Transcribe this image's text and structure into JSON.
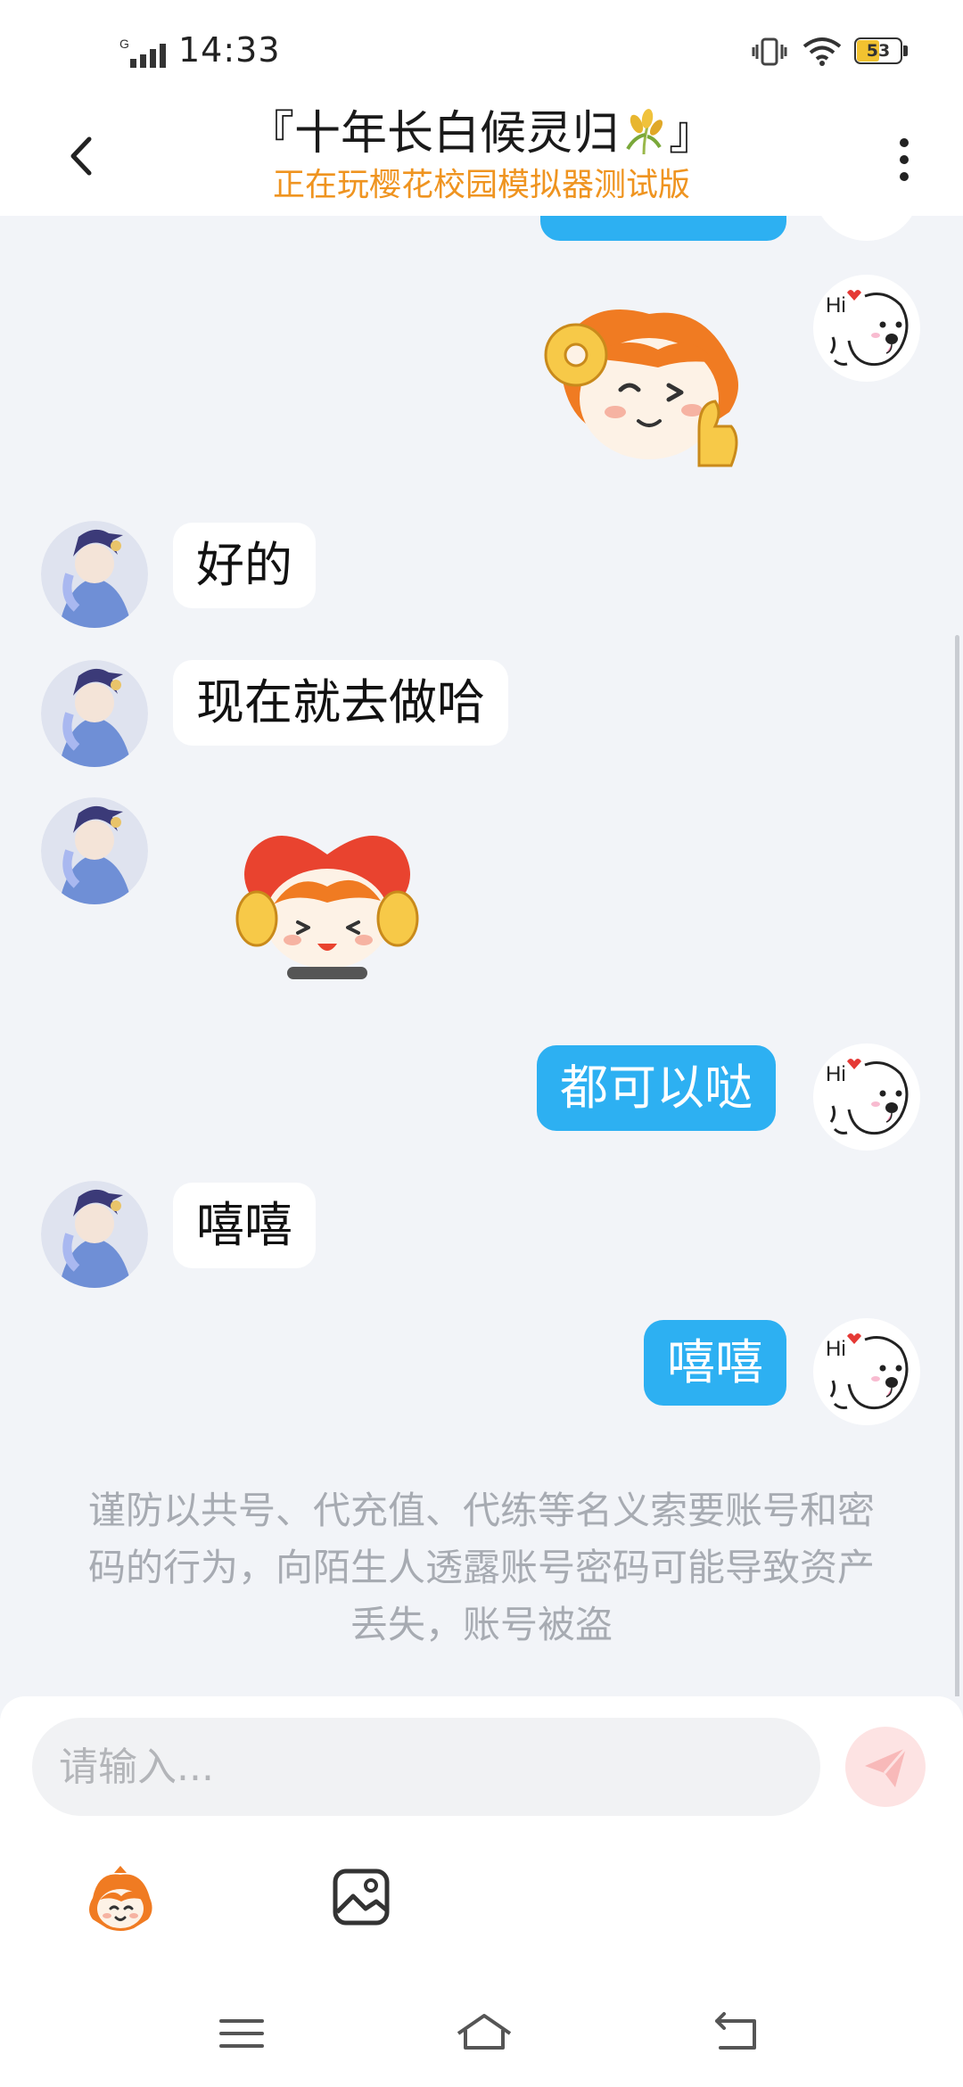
{
  "status_bar": {
    "network": "G",
    "time": "14:33",
    "battery": "53",
    "battery_level": 0.53
  },
  "header": {
    "title_left": "『十年长白候灵归",
    "title_right": "』",
    "title_icon": "wheat-icon",
    "subtitle": "正在玩樱花校园模拟器测试版"
  },
  "messages": [
    {
      "side": "out",
      "type": "sticker",
      "sticker": "ok-thumbs-up-sticker"
    },
    {
      "side": "in",
      "type": "text",
      "text": "好的"
    },
    {
      "side": "in",
      "type": "text",
      "text": "现在就去做哈"
    },
    {
      "side": "in",
      "type": "sticker",
      "sticker": "heart-hug-sticker"
    },
    {
      "side": "out",
      "type": "text",
      "text": "都可以哒"
    },
    {
      "side": "in",
      "type": "text",
      "text": "嘻嘻"
    },
    {
      "side": "out",
      "type": "text",
      "text": "嘻嘻"
    }
  ],
  "notice": "谨防以共号、代充值、代练等名义索要账号和密码的行为，向陌生人透露账号密码可能导致资产丢失，账号被盗",
  "input": {
    "placeholder": "请输入..."
  },
  "toolbar": {
    "icons": [
      "emoji-sticker-icon",
      "image-icon"
    ]
  },
  "nav_bar": {
    "icons": [
      "menu-icon",
      "home-icon",
      "back-nav-icon"
    ]
  },
  "colors": {
    "accent_bubble": "#2db0f2",
    "subtitle": "#ef9420",
    "background": "#f2f4f8",
    "send_button": "#fde3e3"
  }
}
